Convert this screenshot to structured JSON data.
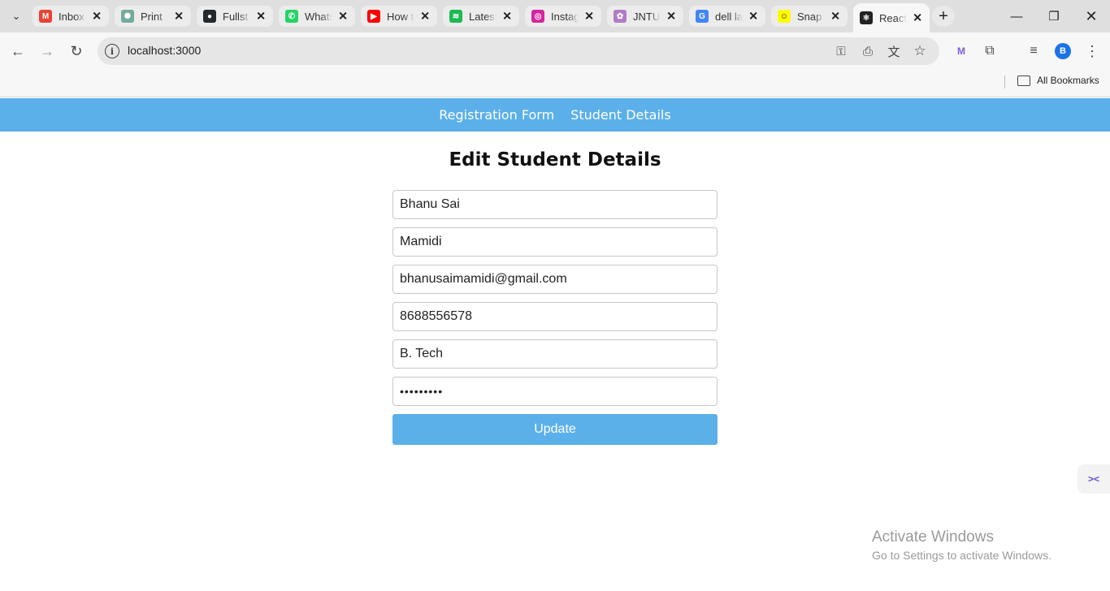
{
  "browser": {
    "tabs": [
      {
        "label": "Inbox",
        "icon": "gmail-icon",
        "color": "#ea4335",
        "glyph": "M"
      },
      {
        "label": "Print",
        "icon": "chatgpt-icon",
        "color": "#74aa9c",
        "glyph": "✺"
      },
      {
        "label": "Fullst",
        "icon": "github-icon",
        "color": "#24292e",
        "glyph": "●"
      },
      {
        "label": "Whats",
        "icon": "whatsapp-icon",
        "color": "#25d366",
        "glyph": "✆"
      },
      {
        "label": "How t",
        "icon": "youtube-icon",
        "color": "#ff0000",
        "glyph": "▶"
      },
      {
        "label": "Latest",
        "icon": "spotify-icon",
        "color": "#1db954",
        "glyph": "≋"
      },
      {
        "label": "Instag",
        "icon": "instagram-icon",
        "color": "#d6249f",
        "glyph": "◎"
      },
      {
        "label": "JNTU",
        "icon": "jntu-icon",
        "color": "#b07cc6",
        "glyph": "✿"
      },
      {
        "label": "dell la",
        "icon": "google-icon",
        "color": "#4285f4",
        "glyph": "G"
      },
      {
        "label": "Snap",
        "icon": "snapchat-icon",
        "color": "#fffc00",
        "glyph": "☺"
      },
      {
        "label": "React",
        "icon": "react-icon",
        "color": "#222222",
        "glyph": "⚛",
        "active": true
      }
    ],
    "url": "localhost:3000",
    "bookmarks_label": "All Bookmarks",
    "profile_initial": "B"
  },
  "nav": {
    "links": [
      "Registration Form",
      "Student Details"
    ]
  },
  "form": {
    "title": "Edit Student Details",
    "first_name": "Bhanu Sai",
    "last_name": "Mamidi",
    "email": "bhanusaimamidi@gmail.com",
    "phone": "8688556578",
    "course": "B. Tech",
    "password": "•••••••••",
    "submit_label": "Update"
  },
  "watermark": {
    "line1": "Activate Windows",
    "line2": "Go to Settings to activate Windows."
  },
  "colors": {
    "accent": "#5bb0ea"
  }
}
